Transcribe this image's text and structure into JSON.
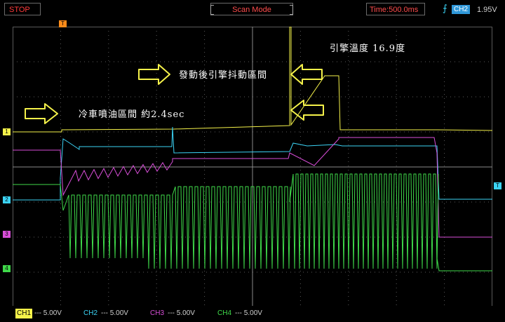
{
  "topbar": {
    "status": "STOP",
    "mode": "Scan Mode",
    "time": "Time:500.0ms",
    "trigger_source": "CH2",
    "trigger_level": "1.95V"
  },
  "markers": {
    "trigger_pos": "T",
    "ch1": "1",
    "ch2": "2",
    "ch3": "3",
    "ch4": "4",
    "trigger_level": "T"
  },
  "channels": [
    {
      "name": "CH1",
      "coupling": "---",
      "scale": "5.00V",
      "color": "#f5f24a"
    },
    {
      "name": "CH2",
      "coupling": "---",
      "scale": "5.00V",
      "color": "#3bd3f5"
    },
    {
      "name": "CH3",
      "coupling": "---",
      "scale": "5.00V",
      "color": "#d84ed8"
    },
    {
      "name": "CH4",
      "coupling": "---",
      "scale": "5.00V",
      "color": "#3fd94a"
    }
  ],
  "annotations": {
    "engine_temp": "引擎溫度 16.9度",
    "post_start_shake": "發動後引擎抖動區間",
    "cold_injection": "冷車噴油區間 約2.4sec"
  },
  "colors": {
    "stop_text": "#ff3b3b",
    "grid": "#5a5a5a",
    "arrow": "#f5f24a",
    "background": "#000000"
  }
}
